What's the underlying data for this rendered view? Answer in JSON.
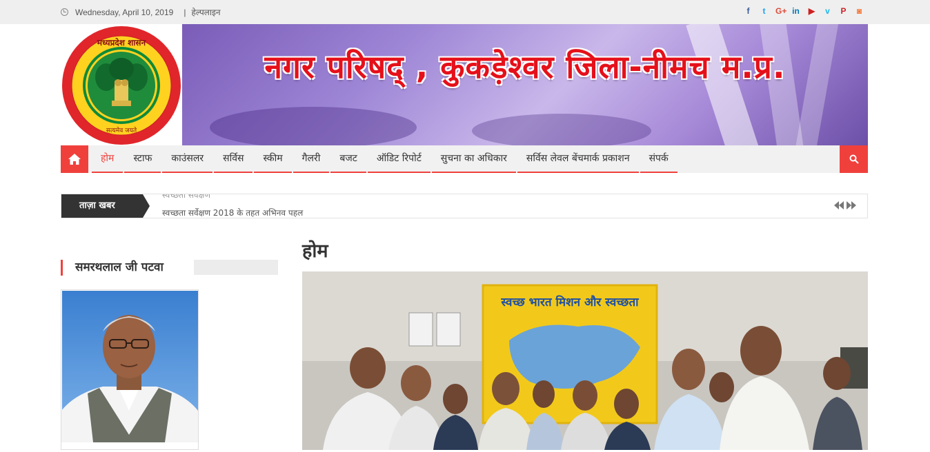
{
  "topbar": {
    "date": "Wednesday, April 10, 2019",
    "separator": "|",
    "helpline": "हेल्पलाइन",
    "social": [
      {
        "name": "facebook-icon",
        "glyph": "f",
        "color": "#3b5998"
      },
      {
        "name": "twitter-icon",
        "glyph": "t",
        "color": "#1da1f2"
      },
      {
        "name": "google-plus-icon",
        "glyph": "G+",
        "color": "#dd4b39"
      },
      {
        "name": "linkedin-icon",
        "glyph": "in",
        "color": "#0077b5"
      },
      {
        "name": "youtube-icon",
        "glyph": "▶",
        "color": "#cd201f"
      },
      {
        "name": "vimeo-icon",
        "glyph": "v",
        "color": "#1ab7ea"
      },
      {
        "name": "pinterest-icon",
        "glyph": "P",
        "color": "#cb2027"
      },
      {
        "name": "instagram-icon",
        "glyph": "◙",
        "color": "#f77737"
      }
    ]
  },
  "header": {
    "banner_title": "नगर परिषद् , कुकड़ेश्वर जिला-नीमच म.प्र.",
    "logo_text_top": "मध्यप्रदेश शासन",
    "logo_text_bottom": "सत्यमेव जयते"
  },
  "nav": {
    "items": [
      {
        "label": "होम",
        "active": true
      },
      {
        "label": "स्टाफ",
        "active": false
      },
      {
        "label": "काउंसलर",
        "active": false
      },
      {
        "label": "सर्विस",
        "active": false
      },
      {
        "label": "स्कीम",
        "active": false
      },
      {
        "label": "गैलरी",
        "active": false
      },
      {
        "label": "बजट",
        "active": false
      },
      {
        "label": "ऑडिट रिपोर्ट",
        "active": false
      },
      {
        "label": "सुचना का अधिकार",
        "active": false
      },
      {
        "label": "सर्विस लेवल बेंचमार्क प्रकाशन",
        "active": false
      },
      {
        "label": "संपर्क",
        "active": false
      }
    ]
  },
  "ticker": {
    "label": "ताज़ा खबर",
    "prev_item": "स्वच्छता सर्वेक्षण",
    "current_item": "स्वच्छता सर्वेक्षण 2018 के तहत अभिनव पहल"
  },
  "sidebar": {
    "heading": "समरथलाल जी पटवा"
  },
  "main": {
    "page_title": "होम",
    "photo_banner_text": "स्वच्छ भारत मिशन और स्वच्छता"
  },
  "colors": {
    "accent": "#f0403c",
    "banner_title": "#e5101a"
  }
}
